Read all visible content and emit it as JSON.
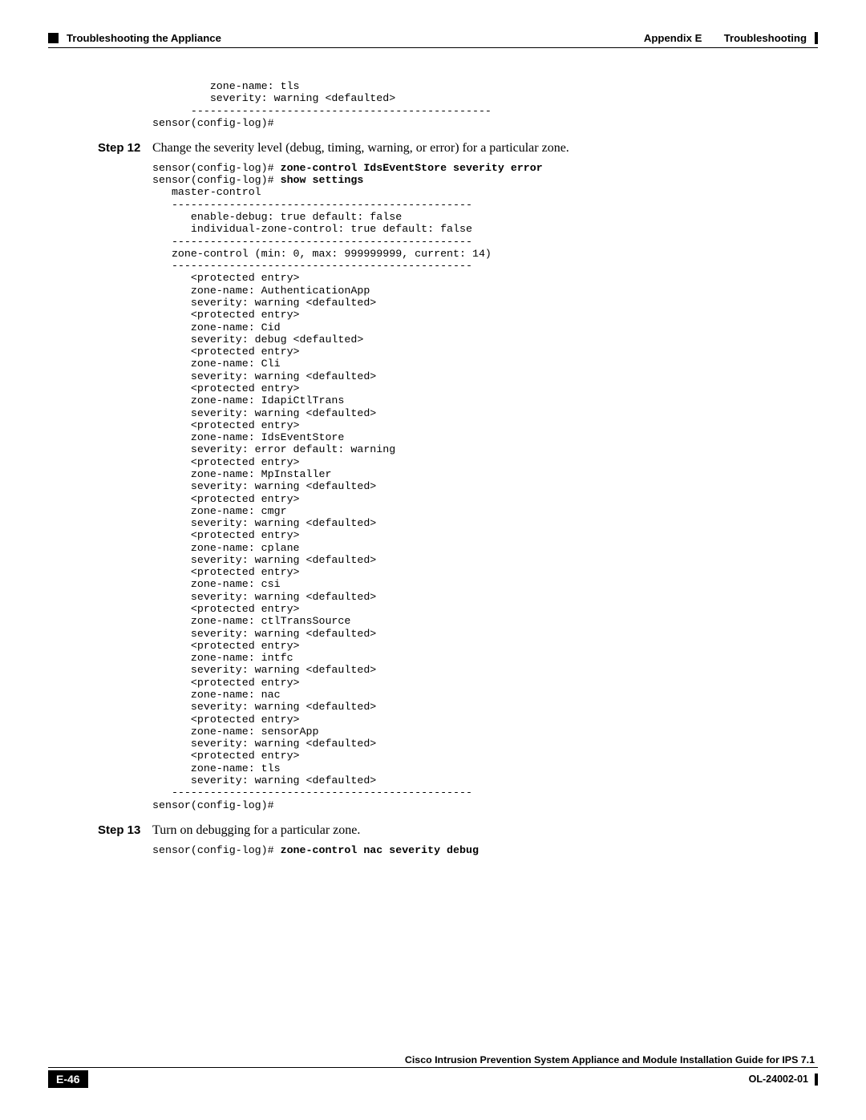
{
  "header": {
    "appendix": "Appendix E",
    "appendixTitle": "Troubleshooting",
    "section": "Troubleshooting the Appliance"
  },
  "block1": "         zone-name: tls\n         severity: warning <defaulted>\n      -----------------------------------------------\nsensor(config-log)#",
  "step12": {
    "label": "Step 12",
    "text": "Change the severity level (debug, timing, warning, or error) for a particular zone."
  },
  "block2_prompt1": "sensor(config-log)# ",
  "block2_cmd1": "zone-control IdsEventStore severity error",
  "block2_prompt2": "sensor(config-log)# ",
  "block2_cmd2": "show settings",
  "block2_body": "   master-control\n   -----------------------------------------------\n      enable-debug: true default: false\n      individual-zone-control: true default: false\n   -----------------------------------------------\n   zone-control (min: 0, max: 999999999, current: 14)\n   -----------------------------------------------\n      <protected entry>\n      zone-name: AuthenticationApp\n      severity: warning <defaulted>\n      <protected entry>\n      zone-name: Cid\n      severity: debug <defaulted>\n      <protected entry>\n      zone-name: Cli\n      severity: warning <defaulted>\n      <protected entry>\n      zone-name: IdapiCtlTrans\n      severity: warning <defaulted>\n      <protected entry>\n      zone-name: IdsEventStore\n      severity: error default: warning\n      <protected entry>\n      zone-name: MpInstaller\n      severity: warning <defaulted>\n      <protected entry>\n      zone-name: cmgr\n      severity: warning <defaulted>\n      <protected entry>\n      zone-name: cplane\n      severity: warning <defaulted>\n      <protected entry>\n      zone-name: csi\n      severity: warning <defaulted>\n      <protected entry>\n      zone-name: ctlTransSource\n      severity: warning <defaulted>\n      <protected entry>\n      zone-name: intfc\n      severity: warning <defaulted>\n      <protected entry>\n      zone-name: nac\n      severity: warning <defaulted>\n      <protected entry>\n      zone-name: sensorApp\n      severity: warning <defaulted>\n      <protected entry>\n      zone-name: tls\n      severity: warning <defaulted>\n   -----------------------------------------------\nsensor(config-log)#",
  "step13": {
    "label": "Step 13",
    "text": "Turn on debugging for a particular zone."
  },
  "block3_prompt": "sensor(config-log)# ",
  "block3_cmd": "zone-control nac severity debug",
  "footer": {
    "title": "Cisco Intrusion Prevention System Appliance and Module Installation Guide for IPS 7.1",
    "page": "E-46",
    "doc": "OL-24002-01"
  }
}
